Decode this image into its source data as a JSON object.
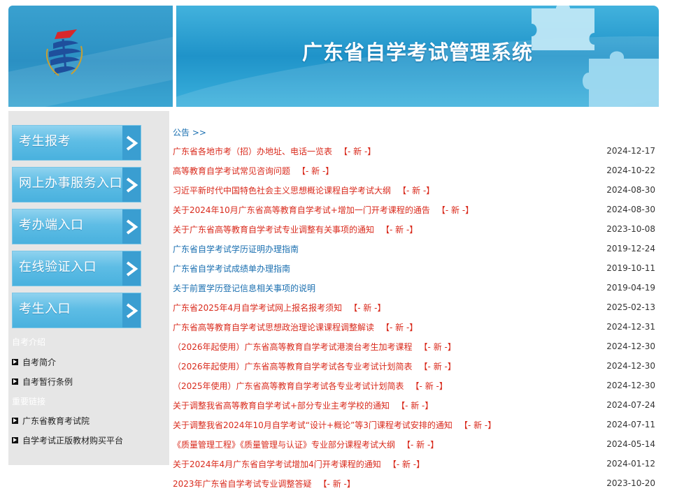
{
  "header": {
    "title": "广东省自学考试管理系统"
  },
  "sidebar": {
    "buttons": [
      {
        "label": "考生报考"
      },
      {
        "label": "网上办事服务入口"
      },
      {
        "label": "考办端入口"
      },
      {
        "label": "在线验证入口"
      },
      {
        "label": "考生入口"
      }
    ],
    "intro_heading": "自考介绍",
    "intro_links": [
      {
        "label": "自考简介"
      },
      {
        "label": "自考暂行条例"
      }
    ],
    "links_heading": "重要链接",
    "important_links": [
      {
        "label": "广东省教育考试院"
      },
      {
        "label": "自学考试正版教材购买平台"
      }
    ]
  },
  "notices": {
    "heading": "公告 >>",
    "new_tag": "【- 新 -】",
    "items": [
      {
        "title": "广东省各地市考（招）办地址、电话一览表",
        "new": true,
        "date": "2024-12-17"
      },
      {
        "title": "高等教育自学考试常见咨询问题",
        "new": true,
        "date": "2024-10-22"
      },
      {
        "title": "习近平新时代中国特色社会主义思想概论课程自学考试大纲",
        "new": true,
        "date": "2024-08-30"
      },
      {
        "title": "关于2024年10月广东省高等教育自学考试+增加一门开考课程的通告",
        "new": true,
        "date": "2024-08-30"
      },
      {
        "title": "关于广东省高等教育自学考试专业调整有关事项的通知",
        "new": true,
        "date": "2023-10-08"
      },
      {
        "title": "广东省自学考试学历证明办理指南",
        "new": false,
        "date": "2019-12-24"
      },
      {
        "title": "广东省自学考试成绩单办理指南",
        "new": false,
        "date": "2019-10-11"
      },
      {
        "title": "关于前置学历登记信息相关事项的说明",
        "new": false,
        "date": "2019-04-19"
      },
      {
        "title": "广东省2025年4月自学考试网上报名报考须知",
        "new": true,
        "date": "2025-02-13"
      },
      {
        "title": "广东省高等教育自学考试思想政治理论课课程调整解读",
        "new": true,
        "date": "2024-12-31"
      },
      {
        "title": "（2026年起使用）广东省高等教育自学考试港澳台考生加考课程",
        "new": true,
        "date": "2024-12-30"
      },
      {
        "title": "（2026年起使用）广东省高等教育自学考试各专业考试计划简表",
        "new": true,
        "date": "2024-12-30"
      },
      {
        "title": "（2025年使用）广东省高等教育自学考试各专业考试计划简表",
        "new": true,
        "date": "2024-12-30"
      },
      {
        "title": "关于调整我省高等教育自学考试+部分专业主考学校的通知",
        "new": true,
        "date": "2024-07-24"
      },
      {
        "title": "关于调整我省2024年10月自学考试“设计+概论”等3门课程考试安排的通知",
        "new": true,
        "date": "2024-07-11"
      },
      {
        "title": "《质量管理工程》《质量管理与认证》专业部分课程考试大纲",
        "new": true,
        "date": "2024-05-14"
      },
      {
        "title": "关于2024年4月广东省自学考试增加4门开考课程的通知",
        "new": true,
        "date": "2024-01-12"
      },
      {
        "title": "2023年广东省自学考试专业调整答疑",
        "new": true,
        "date": "2023-10-20"
      }
    ]
  },
  "colors": {
    "banner": "#1f93c9",
    "new_tag": "#d92a1c",
    "link_blue": "#1a6fb0",
    "sidebar_bg": "#e6e6e6"
  }
}
